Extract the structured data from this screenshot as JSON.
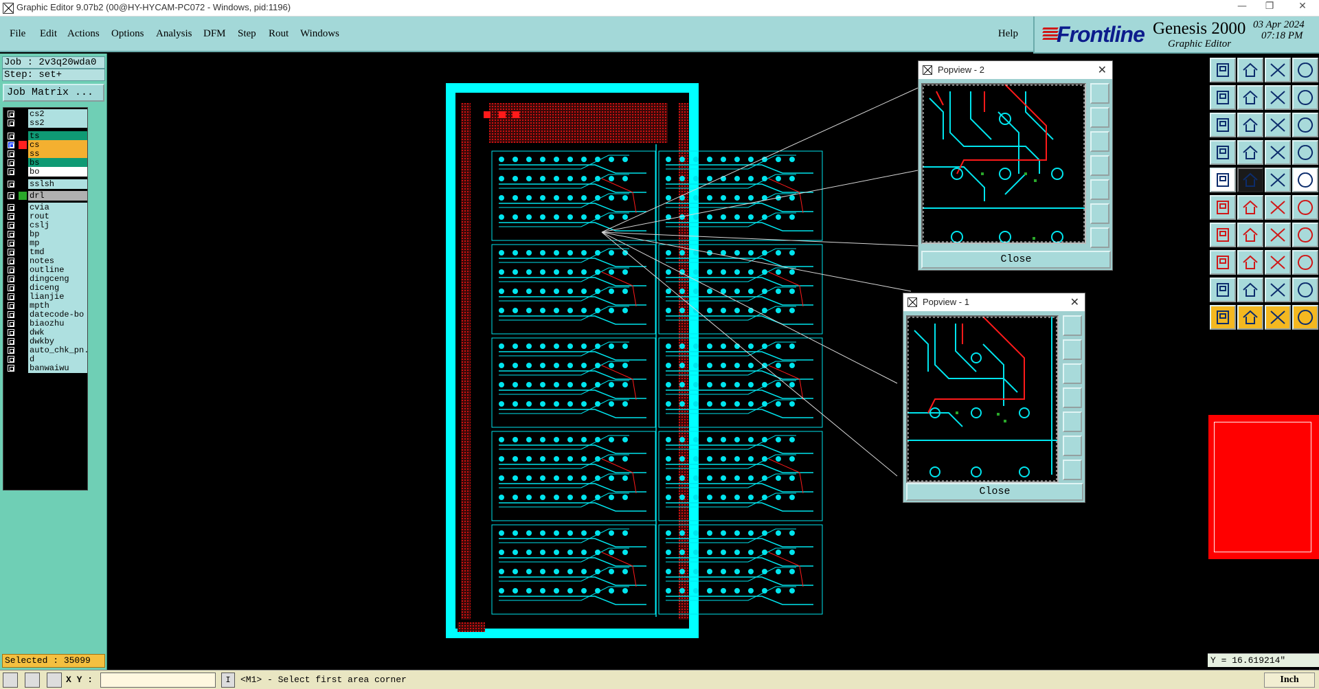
{
  "window": {
    "title": "Graphic Editor 9.07b2 (00@HY-HYCAM-PC072 - Windows, pid:1196)",
    "controls": [
      "—",
      "❐",
      "✕"
    ]
  },
  "menu": {
    "items": [
      "File",
      "Edit",
      "Actions",
      "Options",
      "Analysis",
      "DFM",
      "Step",
      "Rout",
      "Windows"
    ],
    "help": "Help"
  },
  "logo": {
    "brand": "Frontline",
    "product": "Genesis 2000",
    "subtitle": "Graphic Editor",
    "date": "03 Apr 2024",
    "time": "07:18 PM",
    "brand_color": "#0c1c8c",
    "accent_color": "#d01818"
  },
  "job": {
    "job_label": "Job : 2v3q20wda0",
    "step_label": "Step: set+",
    "job_matrix": "Job Matrix ..."
  },
  "layers": [
    {
      "name": "cs2",
      "color": "#000000",
      "label_bg": "#aee0e0"
    },
    {
      "name": "ss2",
      "color": "#000000",
      "label_bg": "#aee0e0"
    },
    {
      "name": "ts",
      "color": "#000000",
      "label_bg": "#0f9a74"
    },
    {
      "name": "cs",
      "color": "#ff2020",
      "label_bg": "#f4b030",
      "active": true
    },
    {
      "name": "ss",
      "color": "#000000",
      "label_bg": "#f4b030"
    },
    {
      "name": "bs",
      "color": "#000000",
      "label_bg": "#0f9a74"
    },
    {
      "name": "bo",
      "color": "#000000",
      "label_bg": "#ffffff"
    },
    {
      "name": "sslsh",
      "color": "#000000",
      "label_bg": "#aee0e0"
    },
    {
      "name": "drl",
      "color": "#2aa82a",
      "label_bg": "#b0b0b0"
    },
    {
      "name": "cvia",
      "color": "#000000",
      "label_bg": "#aee0e0"
    },
    {
      "name": "rout",
      "color": "#000000",
      "label_bg": "#aee0e0"
    },
    {
      "name": "cslj",
      "color": "#000000",
      "label_bg": "#aee0e0"
    },
    {
      "name": "bp",
      "color": "#000000",
      "label_bg": "#aee0e0"
    },
    {
      "name": "mp",
      "color": "#000000",
      "label_bg": "#aee0e0"
    },
    {
      "name": "tmd",
      "color": "#000000",
      "label_bg": "#aee0e0"
    },
    {
      "name": "notes",
      "color": "#000000",
      "label_bg": "#aee0e0"
    },
    {
      "name": "outline",
      "color": "#000000",
      "label_bg": "#aee0e0"
    },
    {
      "name": "dingceng",
      "color": "#000000",
      "label_bg": "#aee0e0"
    },
    {
      "name": "diceng",
      "color": "#000000",
      "label_bg": "#aee0e0"
    },
    {
      "name": "lianjie",
      "color": "#000000",
      "label_bg": "#aee0e0"
    },
    {
      "name": "mpth",
      "color": "#000000",
      "label_bg": "#aee0e0"
    },
    {
      "name": "datecode-bo",
      "color": "#000000",
      "label_bg": "#aee0e0"
    },
    {
      "name": "biaozhu",
      "color": "#000000",
      "label_bg": "#aee0e0"
    },
    {
      "name": "dwk",
      "color": "#000000",
      "label_bg": "#aee0e0"
    },
    {
      "name": "dwkby",
      "color": "#000000",
      "label_bg": "#aee0e0"
    },
    {
      "name": "auto_chk_pn.",
      "color": "#000000",
      "label_bg": "#aee0e0"
    },
    {
      "name": "d",
      "color": "#000000",
      "label_bg": "#aee0e0"
    },
    {
      "name": "banwaiwu",
      "color": "#000000",
      "label_bg": "#aee0e0"
    }
  ],
  "status": {
    "selected": "Selected : 35099",
    "xy_label": "X Y :",
    "xy_value": "",
    "cmd_marker": "I",
    "prompt": "<M1> - Select first area corner",
    "units": "Inch",
    "y_readout": "Y = 16.619214\""
  },
  "popview2": {
    "title": "Popview - 2",
    "close_label": "Close"
  },
  "popview1": {
    "title": "Popview - 1",
    "close_label": "Close"
  },
  "colors": {
    "board_border": "#00ffff",
    "trace": "#00e5ee",
    "copper_red": "#ff1a1a",
    "panel_bg": "#6fcfb5",
    "menu_bg": "#a3d8d8"
  },
  "tools": [
    "top-view-icon",
    "bottom-view-icon",
    "home-icon",
    "window-icon",
    "pan-left-icon",
    "pan-right-icon",
    "undo-icon",
    "redo-icon",
    "fit-icon",
    "zoom-icon",
    "ratio-icon",
    "help-icon",
    "snap-icon",
    "grid-icon",
    "feature-info-icon",
    "measure-icon",
    "pad-icon",
    "line-icon",
    "ruler-icon",
    "circle-icon",
    "move-icon",
    "delete-icon",
    "connect-icon",
    "route-icon",
    "draw-line-icon",
    "draw-arc-icon",
    "rotate-icon",
    "mirror-icon",
    "add-feature-icon",
    "dash-icon",
    "copy-icon",
    "resize-icon",
    "text-a-icon",
    "text-b-icon",
    "text-c-icon",
    "text-d-icon",
    "select-icon",
    "select-pointer-icon",
    "select-area-icon",
    "select-net-icon"
  ]
}
